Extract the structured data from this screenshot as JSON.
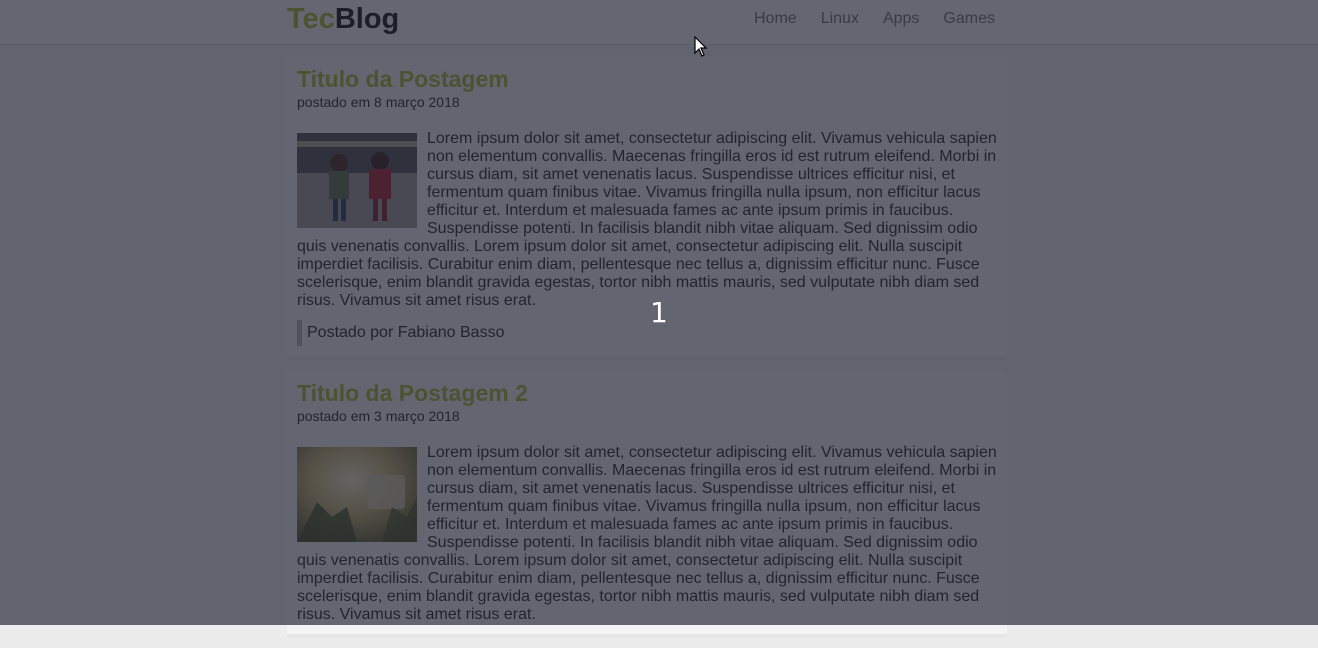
{
  "logo": {
    "part1": "Tec",
    "part2": "Blog"
  },
  "nav": [
    "Home",
    "Linux",
    "Apps",
    "Games"
  ],
  "posts": [
    {
      "title": "Titulo da Postagem",
      "date": "postado em 8 março 2018",
      "body": "Lorem ipsum dolor sit amet, consectetur adipiscing elit. Vivamus vehicula sapien non elementum convallis. Maecenas fringilla eros id est rutrum eleifend. Morbi in cursus diam, sit amet venenatis lacus. Suspendisse ultrices efficitur nisi, et fermentum quam finibus vitae. Vivamus fringilla nulla ipsum, non efficitur lacus efficitur et. Interdum et malesuada fames ac ante ipsum primis in faucibus. Suspendisse potenti. In facilisis blandit nibh vitae aliquam. Sed dignissim odio quis venenatis convallis. Lorem ipsum dolor sit amet, consectetur adipiscing elit. Nulla suscipit imperdiet facilisis. Curabitur enim diam, pellentesque nec tellus a, dignissim efficitur nunc. Fusce scelerisque, enim blandit gravida egestas, tortor nibh mattis mauris, sed vulputate nibh diam sed risus. Vivamus sit amet risus erat.",
      "author": "Postado por Fabiano Basso"
    },
    {
      "title": "Titulo da Postagem 2",
      "date": "postado em 3 março 2018",
      "body": "Lorem ipsum dolor sit amet, consectetur adipiscing elit. Vivamus vehicula sapien non elementum convallis. Maecenas fringilla eros id est rutrum eleifend. Morbi in cursus diam, sit amet venenatis lacus. Suspendisse ultrices efficitur nisi, et fermentum quam finibus vitae. Vivamus fringilla nulla ipsum, non efficitur lacus efficitur et. Interdum et malesuada fames ac ante ipsum primis in faucibus. Suspendisse potenti. In facilisis blandit nibh vitae aliquam. Sed dignissim odio quis venenatis convallis. Lorem ipsum dolor sit amet, consectetur adipiscing elit. Nulla suscipit imperdiet facilisis. Curabitur enim diam, pellentesque nec tellus a, dignissim efficitur nunc. Fusce scelerisque, enim blandit gravida egestas, tortor nibh mattis mauris, sed vulputate nibh diam sed risus. Vivamus sit amet risus erat."
    }
  ],
  "overlay_counter": "1",
  "colors": {
    "accent": "#a8c23a",
    "overlay": "#191c2d"
  }
}
